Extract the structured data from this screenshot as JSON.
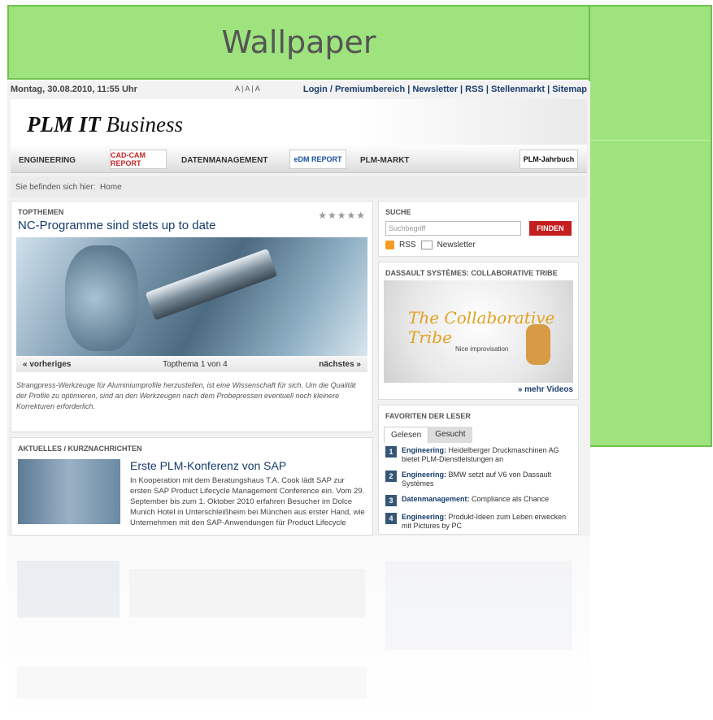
{
  "wallpaper": {
    "title": "Wallpaper",
    "color": "#9ee37e"
  },
  "site": {
    "topbar": {
      "date": "Montag, 30.08.2010, 11:55 Uhr",
      "font_sizes": "A | A | A",
      "links": "Login / Premiumbereich | Newsletter | RSS | Stellenmarkt | Sitemap"
    },
    "logo": {
      "strong": "PLM IT",
      "rest": " Business"
    },
    "nav": {
      "engineering": "ENGINEERING",
      "cadcam_badge": "CAD-CAM REPORT",
      "datenmanagement": "DATENMANAGEMENT",
      "edm_badge": "eDM REPORT",
      "plmmarkt": "PLM-MARKT",
      "jahrbuch_badge": "PLM-Jahrbuch"
    },
    "breadcrumb": {
      "label": "Sie befinden sich hier:",
      "home": "Home"
    },
    "topthemen": {
      "title": "TOPTHEMEN",
      "stars": "★★★★★",
      "headline": "NC-Programme sind stets up to date",
      "prev": "« vorheriges",
      "counter": "Topthema 1 von 4",
      "next": "nächstes »",
      "teaser": "Strangpress-Werkzeuge für Aluminiumprofile herzustellen, ist eine Wissenschaft für sich. Um die Qualität der Profile zu optimieren, sind an den Werkzeugen nach dem Probepressen eventuell noch kleinere Korrekturen erforderlich."
    },
    "aktuelles": {
      "title": "AKTUELLES / KURZNACHRICHTEN",
      "headline": "Erste PLM-Konferenz von SAP",
      "text": "In Kooperation mit dem Beratungshaus T.A. Cook lädt SAP zur ersten SAP Product Lifecycle Management Conference ein. Vom 29. September bis zum 1. Oktober 2010 erfahren Besucher im Dolce Munich Hotel in Unterschleißheim bei München aus erster Hand, wie Unternehmen mit den SAP-Anwendungen für Product Lifecycle"
    },
    "suche": {
      "title": "SUCHE",
      "placeholder": "Suchbegriff",
      "button": "FINDEN",
      "rss": "RSS",
      "newsletter": "Newsletter"
    },
    "video": {
      "title": "DASSAULT SYSTÈMES: COLLABORATIVE TRIBE",
      "video_title": "The Collaborative Tribe",
      "video_sub": "Nice improvisation",
      "more": "» mehr Videos"
    },
    "favoriten": {
      "title": "FAVORITEN DER LESER",
      "tab_gelesen": "Gelesen",
      "tab_gesucht": "Gesucht",
      "items": [
        {
          "num": "1",
          "cat": "Engineering:",
          "text": " Heidelberger Druckmaschinen AG bietet PLM-Dienstleistungen an"
        },
        {
          "num": "2",
          "cat": "Engineering:",
          "text": " BMW setzt auf V6 von Dassault Systèmes"
        },
        {
          "num": "3",
          "cat": "Datenmanagement:",
          "text": " Compliance als Chance"
        },
        {
          "num": "4",
          "cat": "Engineering:",
          "text": " Produkt-Ideen zum Leben erwecken mit Pictures by PC"
        }
      ]
    }
  }
}
